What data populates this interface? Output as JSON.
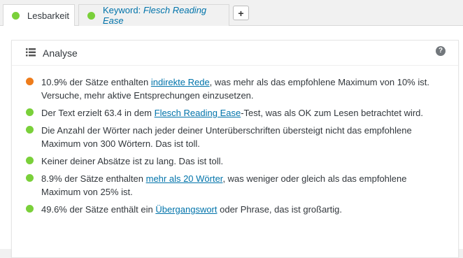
{
  "colors": {
    "good": "#7ad03a",
    "ok": "#ee7c1b",
    "link": "#0073aa"
  },
  "tabs": [
    {
      "label": "Lesbarkeit",
      "status": "good",
      "active": true
    },
    {
      "label_prefix": "Keyword:",
      "label_keyword": "Flesch Reading Ease",
      "status": "good",
      "active": false
    }
  ],
  "add_tab_label": "+",
  "panel": {
    "title": "Analyse",
    "icon": "list-icon",
    "help_icon": "?",
    "items": [
      {
        "status": "ok",
        "before": "10.9% der Sätze enthalten ",
        "link": "indirekte Rede",
        "after": ", was mehr als das empfohlene Maximum von 10% ist. Versuche, mehr aktive Entsprechungen einzusetzen."
      },
      {
        "status": "good",
        "before": "Der Text erzielt 63.4 in dem ",
        "link": "Flesch Reading Ease",
        "after": "-Test, was als OK zum Lesen betrachtet wird."
      },
      {
        "status": "good",
        "before": "Die Anzahl der Wörter nach jeder deiner Unterüberschriften übersteigt nicht das empfohlene Maximum von 300 Wörtern. Das ist toll.",
        "link": "",
        "after": ""
      },
      {
        "status": "good",
        "before": "Keiner deiner Absätze ist zu lang. Das ist toll.",
        "link": "",
        "after": ""
      },
      {
        "status": "good",
        "before": "8.9% der Sätze enthalten ",
        "link": "mehr als 20 Wörter",
        "after": ", was weniger oder gleich als das empfohlene Maximum von 25% ist."
      },
      {
        "status": "good",
        "before": "49.6% der Sätze enthält ein ",
        "link": "Übergangswort",
        "after": " oder Phrase, das ist großartig."
      }
    ]
  }
}
